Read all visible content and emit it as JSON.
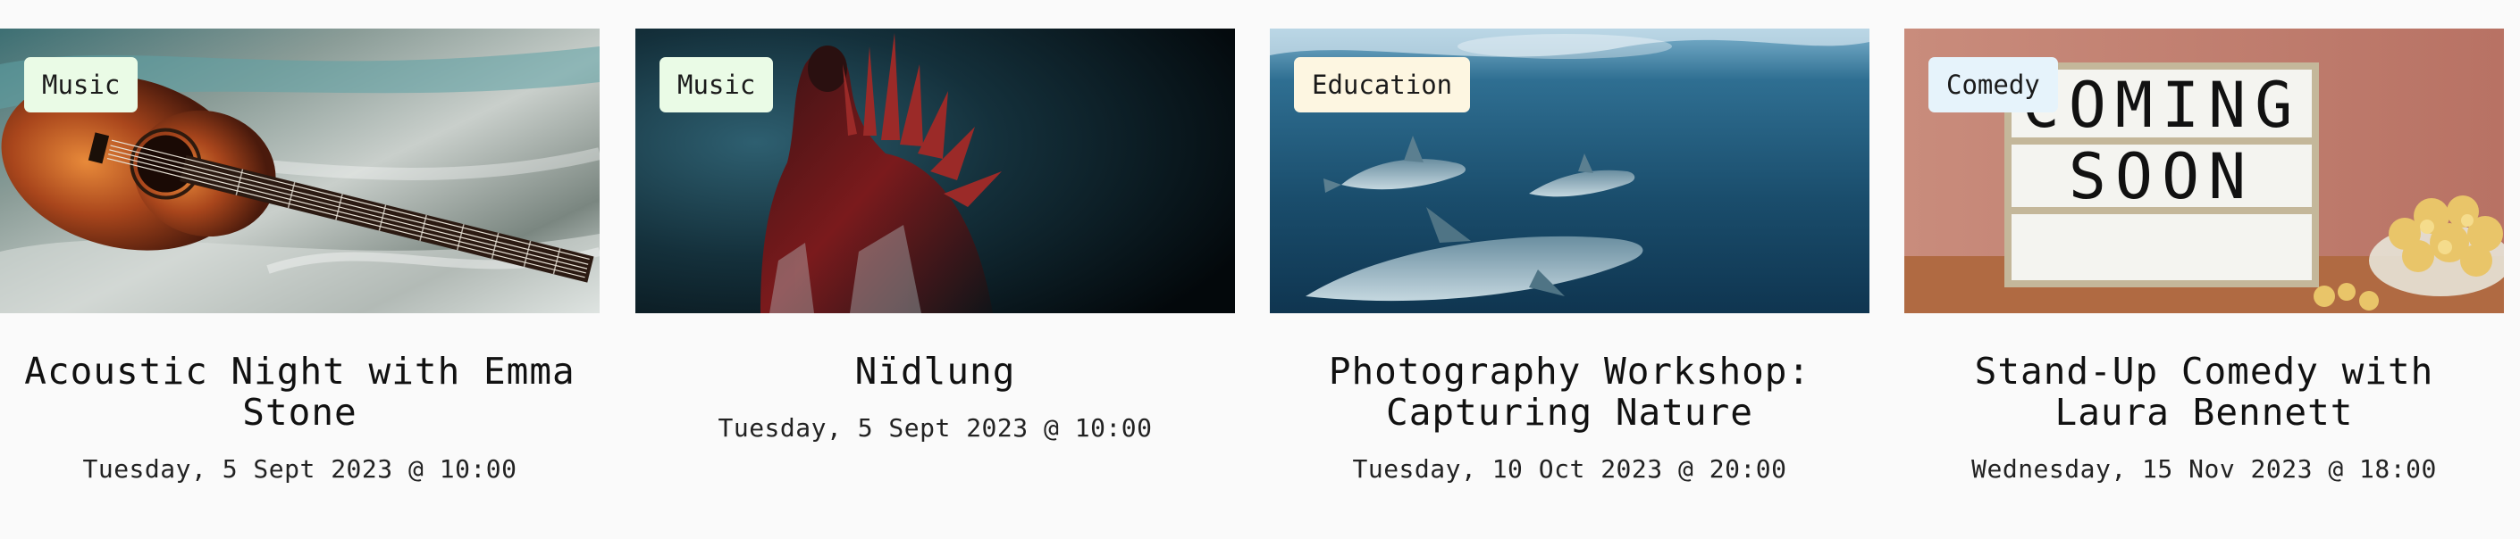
{
  "events": [
    {
      "category": "Music",
      "title": "Acoustic Night with Emma Stone",
      "date": "Tuesday, 5 Sept 2023 @ 10:00",
      "image": "acoustic-guitar-photo"
    },
    {
      "category": "Music",
      "title": "Nïdlung",
      "date": "Tuesday, 5 Sept 2023 @ 10:00",
      "image": "spiked-figure-dark-photo"
    },
    {
      "category": "Education",
      "title": "Photography Workshop: Capturing Nature",
      "date": "Tuesday, 10 Oct 2023 @ 20:00",
      "image": "dolphins-underwater-photo"
    },
    {
      "category": "Comedy",
      "title": "Stand-Up Comedy with Laura Bennett",
      "date": "Wednesday, 15 Nov 2023 @ 18:00",
      "image": "coming-soon-lightbox-photo",
      "image_text": [
        "COMING",
        "SOON"
      ]
    }
  ],
  "colors": {
    "badge_music": "#eafbe6",
    "badge_education": "#fdf6e1",
    "badge_comedy": "#e6f3fb",
    "background": "#fafafa"
  }
}
